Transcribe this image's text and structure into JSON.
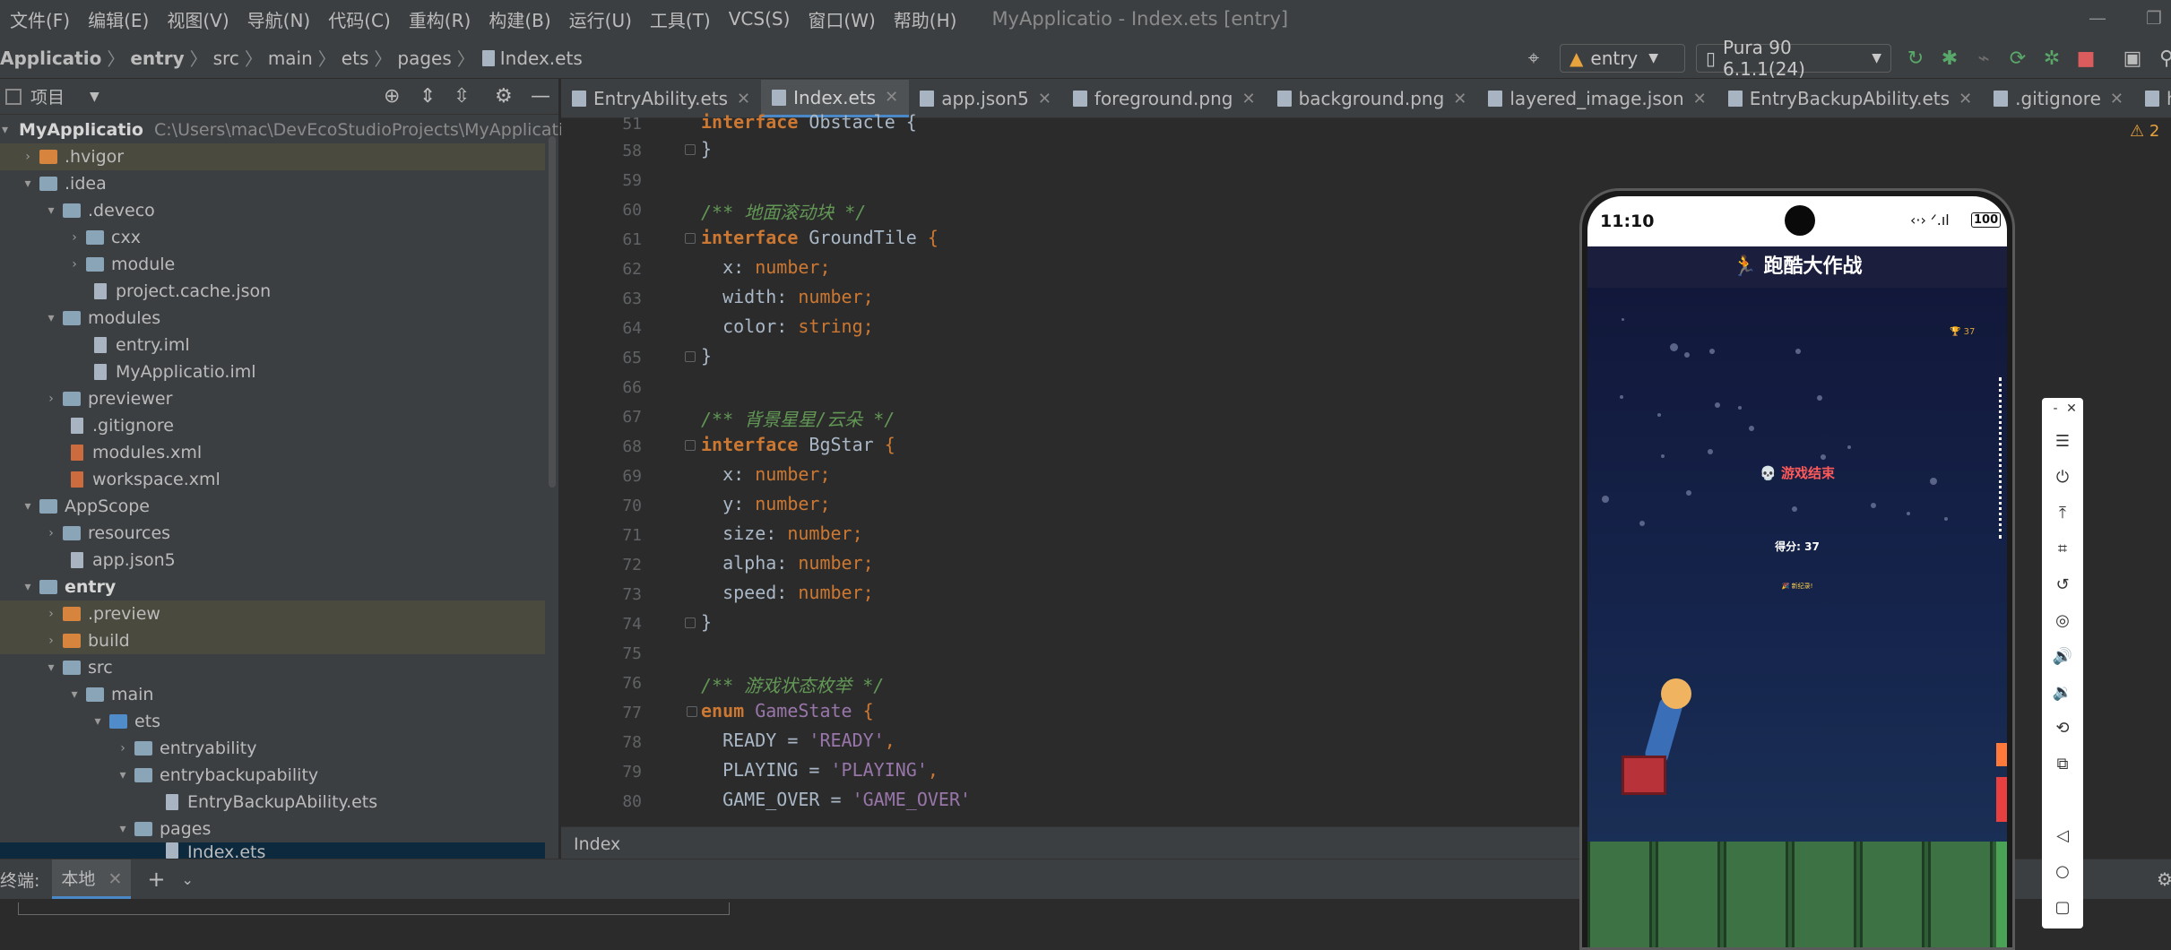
{
  "menu": {
    "items": [
      "文件(F)",
      "编辑(E)",
      "视图(V)",
      "导航(N)",
      "代码(C)",
      "重构(R)",
      "构建(B)",
      "运行(U)",
      "工具(T)",
      "VCS(S)",
      "窗口(W)",
      "帮助(H)"
    ],
    "window_title": "MyApplicatio - Index.ets [entry]"
  },
  "nav": {
    "crumbs": [
      "Applicatio",
      "entry",
      "src",
      "main",
      "ets",
      "pages",
      "Index.ets"
    ],
    "module_select": "entry",
    "device_select": "Pura 90 6.1.1(24)"
  },
  "project": {
    "header_label": "项目",
    "tree": [
      {
        "label": "MyApplicatio",
        "extra": "C:\\Users\\mac\\DevEcoStudioProjects\\MyApplicatio",
        "bold": true
      },
      {
        "label": ".hvigor"
      },
      {
        "label": ".idea"
      },
      {
        "label": ".deveco"
      },
      {
        "label": "cxx"
      },
      {
        "label": "module"
      },
      {
        "label": "project.cache.json"
      },
      {
        "label": "modules"
      },
      {
        "label": "entry.iml"
      },
      {
        "label": "MyApplicatio.iml"
      },
      {
        "label": "previewer"
      },
      {
        "label": ".gitignore"
      },
      {
        "label": "modules.xml"
      },
      {
        "label": "workspace.xml"
      },
      {
        "label": "AppScope"
      },
      {
        "label": "resources"
      },
      {
        "label": "app.json5"
      },
      {
        "label": "entry",
        "bold": true
      },
      {
        "label": ".preview"
      },
      {
        "label": "build"
      },
      {
        "label": "src"
      },
      {
        "label": "main"
      },
      {
        "label": "ets"
      },
      {
        "label": "entryability"
      },
      {
        "label": "entrybackupability"
      },
      {
        "label": "EntryBackupAbility.ets"
      },
      {
        "label": "pages"
      },
      {
        "label": "Index.ets"
      }
    ]
  },
  "tabs": [
    "EntryAbility.ets",
    "Index.ets",
    "app.json5",
    "foreground.png",
    "background.png",
    "layered_image.json",
    "EntryBackupAbility.ets",
    ".gitignore",
    "hvigor-con"
  ],
  "editor": {
    "warnings": "2",
    "lines": [
      {
        "n": "51",
        "text": "interface Obstacle {"
      },
      {
        "n": "58",
        "text": "}"
      },
      {
        "n": "59",
        "text": ""
      },
      {
        "n": "60",
        "text": "/** 地面滚动块 */"
      },
      {
        "n": "61",
        "text": "interface GroundTile {"
      },
      {
        "n": "62",
        "text": "  x: number;"
      },
      {
        "n": "63",
        "text": "  width: number;"
      },
      {
        "n": "64",
        "text": "  color: string;"
      },
      {
        "n": "65",
        "text": "}"
      },
      {
        "n": "66",
        "text": ""
      },
      {
        "n": "67",
        "text": "/** 背景星星/云朵 */"
      },
      {
        "n": "68",
        "text": "interface BgStar {"
      },
      {
        "n": "69",
        "text": "  x: number;"
      },
      {
        "n": "70",
        "text": "  y: number;"
      },
      {
        "n": "71",
        "text": "  size: number;"
      },
      {
        "n": "72",
        "text": "  alpha: number;"
      },
      {
        "n": "73",
        "text": "  speed: number;"
      },
      {
        "n": "74",
        "text": "}"
      },
      {
        "n": "75",
        "text": ""
      },
      {
        "n": "76",
        "text": "/** 游戏状态枚举 */"
      },
      {
        "n": "77",
        "text": "enum GameState {"
      },
      {
        "n": "78",
        "text": "  READY = 'READY',"
      },
      {
        "n": "79",
        "text": "  PLAYING = 'PLAYING',"
      },
      {
        "n": "80",
        "text": "  GAME_OVER = 'GAME_OVER'"
      }
    ],
    "breadcrumb": "Index"
  },
  "terminal": {
    "label": "终端:",
    "tab": "本地"
  },
  "phone": {
    "time": "11:10",
    "battery": "100",
    "app_title": "🏃 跑酷大作战",
    "best": "37",
    "game_over": "💀 游戏结束",
    "score": "得分: 37",
    "record": "🎉 新纪录!"
  }
}
